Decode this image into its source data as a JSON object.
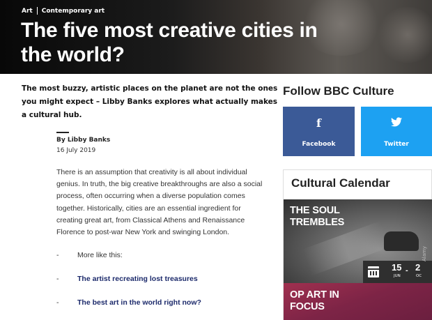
{
  "breadcrumb": {
    "items": [
      "Art",
      "Contemporary art"
    ]
  },
  "article": {
    "title": "The five most creative cities in the world?",
    "standfirst": "The most buzzy, artistic places on the planet are not the ones you might expect – Libby Banks explores what actually makes a cultural hub.",
    "byline": "By Libby Banks",
    "date": "16 July 2019",
    "body": "There is an assumption that creativity is all about individual genius. In truth, the big creative breakthroughs are also a social process, often occurring when a diverse population comes together. Historically, cities are an essential ingredient for creating great art, from Classical Athens and Renaissance Florence to post-war New York and swinging London.",
    "more_like_this": {
      "label": "More like this:",
      "links": [
        "The artist recreating lost treasures",
        "The best art in the world right now?"
      ]
    }
  },
  "sidebar": {
    "follow_heading": "Follow BBC Culture",
    "social": [
      {
        "label": "Facebook",
        "icon": "facebook-icon",
        "glyph": "f",
        "color": "#3b5a97"
      },
      {
        "label": "Twitter",
        "icon": "twitter-icon",
        "glyph": "🐦",
        "color": "#1da1f2"
      }
    ],
    "calendar_heading": "Cultural Calendar",
    "events": [
      {
        "title": "THE SOUL TREMBLES",
        "date_start": "15",
        "month_start": "JUN",
        "date_end": "2",
        "month_end": "OC"
      },
      {
        "title": "OP ART IN FOCUS"
      }
    ],
    "image_credit": "Alamy"
  }
}
